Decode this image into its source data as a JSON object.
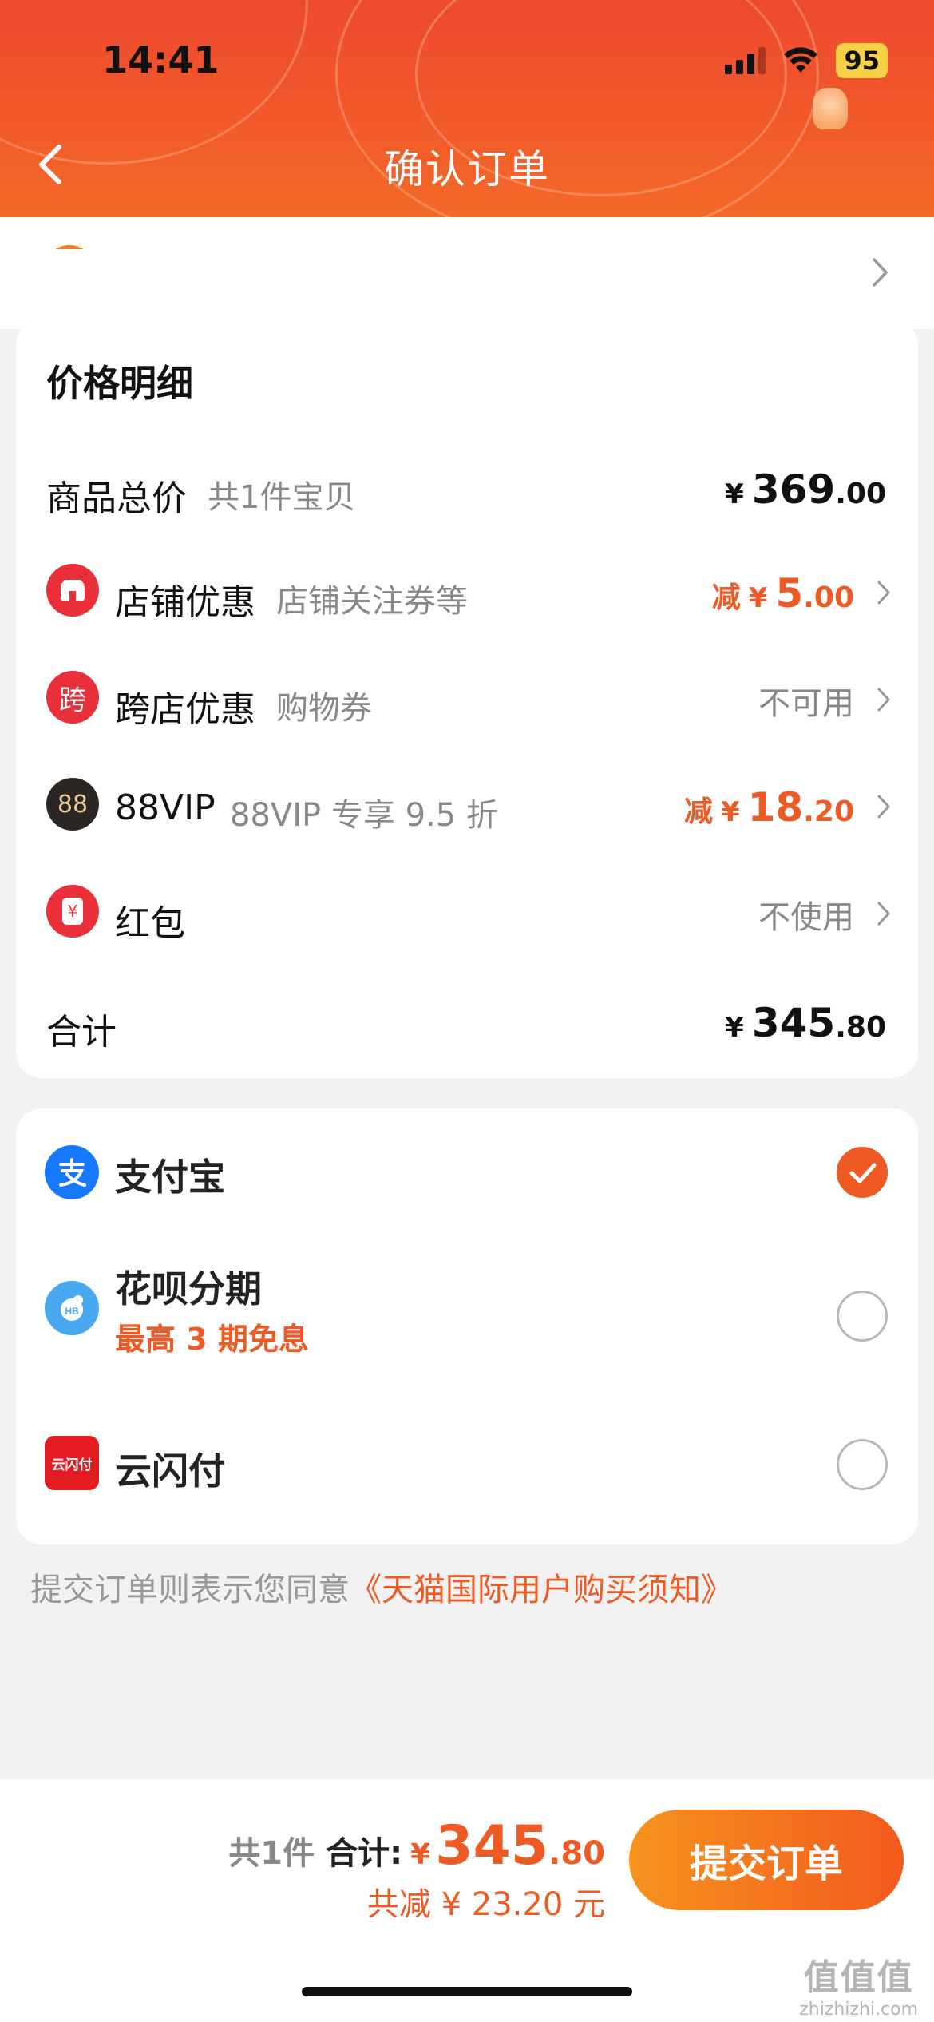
{
  "status_bar": {
    "time": "14:41",
    "battery": "95"
  },
  "header": {
    "title": "确认订单"
  },
  "price_detail": {
    "title": "价格明细",
    "goods_total": {
      "label": "商品总价",
      "sub": "共1件宝贝",
      "yen": "¥",
      "int": "369",
      "dec": ".00"
    },
    "shop_discount": {
      "label": "店铺优惠",
      "sub": "店铺关注券等",
      "prefix": "减",
      "yen": "¥",
      "int": "5",
      "dec": ".00"
    },
    "cross_shop": {
      "icon_char": "跨",
      "label": "跨店优惠",
      "sub": "购物券",
      "status": "不可用"
    },
    "vip": {
      "icon_char": "88",
      "label": "88VIP",
      "sub": "88VIP 专享 9.5 折",
      "prefix": "减",
      "yen": "¥",
      "int": "18",
      "dec": ".20"
    },
    "red_packet": {
      "icon_char": "¥",
      "label": "红包",
      "status": "不使用"
    },
    "total": {
      "label": "合计",
      "yen": "¥",
      "int": "345",
      "dec": ".80"
    }
  },
  "payment": {
    "alipay": {
      "label": "支付宝",
      "selected": true
    },
    "huabei": {
      "label": "花呗分期",
      "sub": "最高 3 期免息",
      "selected": false
    },
    "unionpay": {
      "label": "云闪付",
      "icon_text": "云闪付",
      "selected": false
    }
  },
  "agreement": {
    "text": "提交订单则表示您同意",
    "link": "《天猫国际用户购买须知》"
  },
  "bottom_bar": {
    "count": "共1件",
    "total_label": "合计:",
    "yen": "¥",
    "int": "345",
    "dec": ".80",
    "saved": "共减 ¥ 23.20 元",
    "submit": "提交订单"
  },
  "watermark": {
    "main": "值值值",
    "sub": "zhizhizhi.com"
  },
  "colors": {
    "accent": "#ee5a23",
    "header": "#ef4d2d"
  }
}
